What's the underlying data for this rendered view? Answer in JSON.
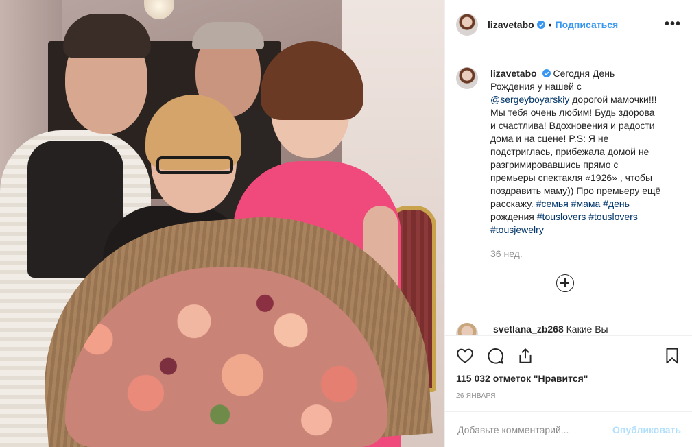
{
  "header": {
    "username": "lizavetabo",
    "separator": "•",
    "follow_label": "Подписаться",
    "more_label": "•••"
  },
  "caption": {
    "username": "lizavetabo",
    "text_1": "Сегодня День Рождения у нашей с ",
    "mention": "@sergeyboyarskiy",
    "text_2": " дорогой мамочки!!! Мы тебя очень любим! Будь здорова и счастлива! Вдохновения и радости дома и на сцене! P.S: Я не подстриглась, прибежала домой не разгримировавшись прямо с премьеры спектакля «1926» , чтобы поздравить маму)) Про премьеру ещё расскажу. ",
    "tag_1": "#семья",
    "tag_2": "#мама",
    "tag_3": "#день",
    "text_3": " рождения ",
    "tag_4": "#touslovers",
    "tag_5": "#touslovers",
    "tag_6": "#tousjewelry",
    "time": "36 нед."
  },
  "comment": {
    "username": "svetlana_zb268",
    "text": "Какие Вы"
  },
  "actions": {
    "likes": "115 032 отметок \"Нравится\"",
    "date": "26 ЯНВАРЯ"
  },
  "add_comment": {
    "placeholder": "Добавьте комментарий...",
    "publish_label": "Опубликовать"
  },
  "colors": {
    "link": "#3897f0",
    "hashtag": "#003569",
    "muted": "#8e8e8e",
    "publish_disabled": "#b2dffc"
  }
}
